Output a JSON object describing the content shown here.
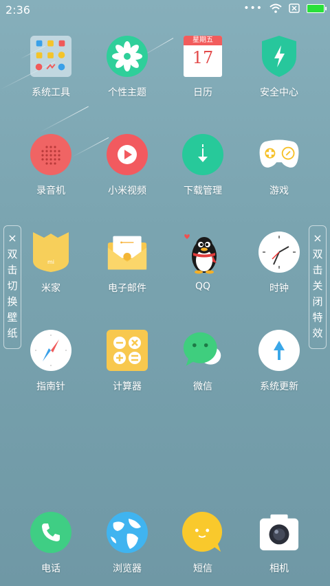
{
  "status_bar": {
    "time": "2:36",
    "more": "•••"
  },
  "apps": [
    {
      "label": "系统工具"
    },
    {
      "label": "个性主题"
    },
    {
      "label": "日历",
      "weekday": "星期五",
      "day": "17"
    },
    {
      "label": "安全中心"
    },
    {
      "label": "录音机"
    },
    {
      "label": "小米视频"
    },
    {
      "label": "下载管理"
    },
    {
      "label": "游戏"
    },
    {
      "label": "米家"
    },
    {
      "label": "电子邮件"
    },
    {
      "label": "QQ"
    },
    {
      "label": "时钟"
    },
    {
      "label": "指南针"
    },
    {
      "label": "计算器"
    },
    {
      "label": "微信"
    },
    {
      "label": "系统更新"
    }
  ],
  "dock": [
    {
      "label": "电话"
    },
    {
      "label": "浏览器"
    },
    {
      "label": "短信"
    },
    {
      "label": "相机"
    }
  ],
  "side_left": {
    "close": "×",
    "chars": [
      "双",
      "击",
      "切",
      "换",
      "壁",
      "纸"
    ]
  },
  "side_right": {
    "close": "×",
    "chars": [
      "双",
      "击",
      "关",
      "闭",
      "特",
      "效"
    ]
  }
}
